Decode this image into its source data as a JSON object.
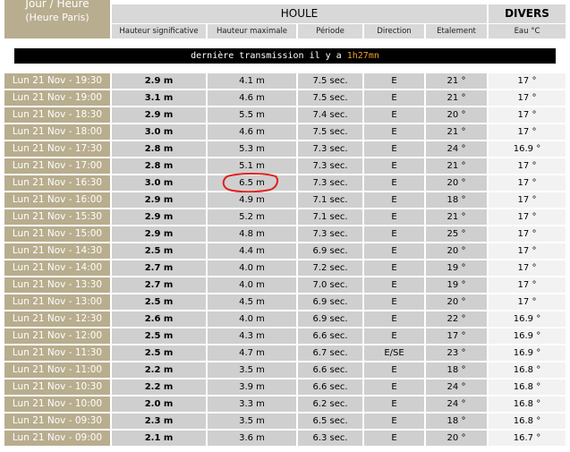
{
  "header": {
    "date_line1": "Jour / Heure",
    "date_line2": "(Heure Paris)",
    "group_houle": "HOULE",
    "group_divers": "DIVERS",
    "columns": [
      "Hauteur significative",
      "Hauteur maximale",
      "Période",
      "Direction",
      "Etalement",
      "Eau °C"
    ]
  },
  "banner": {
    "prefix": "dernière transmission il y a ",
    "elapsed": "1h27mn"
  },
  "rows": [
    [
      "Lun 21 Nov - 19:30",
      "2.9 m",
      "4.1 m",
      "7.5 sec.",
      "E",
      "21 °",
      "17 °"
    ],
    [
      "Lun 21 Nov - 19:00",
      "3.1 m",
      "4.6 m",
      "7.5 sec.",
      "E",
      "21 °",
      "17 °"
    ],
    [
      "Lun 21 Nov - 18:30",
      "2.9 m",
      "5.5 m",
      "7.4 sec.",
      "E",
      "20 °",
      "17 °"
    ],
    [
      "Lun 21 Nov - 18:00",
      "3.0 m",
      "4.6 m",
      "7.5 sec.",
      "E",
      "21 °",
      "17 °"
    ],
    [
      "Lun 21 Nov - 17:30",
      "2.8 m",
      "5.3 m",
      "7.3 sec.",
      "E",
      "24 °",
      "16.9 °"
    ],
    [
      "Lun 21 Nov - 17:00",
      "2.8 m",
      "5.1 m",
      "7.3 sec.",
      "E",
      "21 °",
      "17 °"
    ],
    [
      "Lun 21 Nov - 16:30",
      "3.0 m",
      "6.5 m",
      "7.3 sec.",
      "E",
      "20 °",
      "17 °"
    ],
    [
      "Lun 21 Nov - 16:00",
      "2.9 m",
      "4.9 m",
      "7.1 sec.",
      "E",
      "18 °",
      "17 °"
    ],
    [
      "Lun 21 Nov - 15:30",
      "2.9 m",
      "5.2 m",
      "7.1 sec.",
      "E",
      "21 °",
      "17 °"
    ],
    [
      "Lun 21 Nov - 15:00",
      "2.9 m",
      "4.8 m",
      "7.3 sec.",
      "E",
      "25 °",
      "17 °"
    ],
    [
      "Lun 21 Nov - 14:30",
      "2.5 m",
      "4.4 m",
      "6.9 sec.",
      "E",
      "20 °",
      "17 °"
    ],
    [
      "Lun 21 Nov - 14:00",
      "2.7 m",
      "4.0 m",
      "7.2 sec.",
      "E",
      "19 °",
      "17 °"
    ],
    [
      "Lun 21 Nov - 13:30",
      "2.7 m",
      "4.0 m",
      "7.0 sec.",
      "E",
      "19 °",
      "17 °"
    ],
    [
      "Lun 21 Nov - 13:00",
      "2.5 m",
      "4.5 m",
      "6.9 sec.",
      "E",
      "20 °",
      "17 °"
    ],
    [
      "Lun 21 Nov - 12:30",
      "2.6 m",
      "4.0 m",
      "6.9 sec.",
      "E",
      "22 °",
      "16.9 °"
    ],
    [
      "Lun 21 Nov - 12:00",
      "2.5 m",
      "4.3 m",
      "6.6 sec.",
      "E",
      "17 °",
      "16.9 °"
    ],
    [
      "Lun 21 Nov - 11:30",
      "2.5 m",
      "4.7 m",
      "6.7 sec.",
      "E/SE",
      "23 °",
      "16.9 °"
    ],
    [
      "Lun 21 Nov - 11:00",
      "2.2 m",
      "3.5 m",
      "6.6 sec.",
      "E",
      "18 °",
      "16.8 °"
    ],
    [
      "Lun 21 Nov - 10:30",
      "2.2 m",
      "3.9 m",
      "6.6 sec.",
      "E",
      "24 °",
      "16.8 °"
    ],
    [
      "Lun 21 Nov - 10:00",
      "2.0 m",
      "3.3 m",
      "6.2 sec.",
      "E",
      "24 °",
      "16.8 °"
    ],
    [
      "Lun 21 Nov - 09:30",
      "2.3 m",
      "3.5 m",
      "6.5 sec.",
      "E",
      "18 °",
      "16.8 °"
    ],
    [
      "Lun 21 Nov - 09:00",
      "2.1 m",
      "3.6 m",
      "6.3 sec.",
      "E",
      "20 °",
      "16.7 °"
    ]
  ],
  "colors": {
    "date_bg": "#b8ad8e",
    "value_bg": "#cfcfcf",
    "water_bg": "#f2f2f2",
    "banner_bg": "#000000",
    "banner_accent": "#f0a030",
    "annotation": "#e02020"
  },
  "annotation": {
    "icon": "red-hand-drawn-circle-icon"
  }
}
